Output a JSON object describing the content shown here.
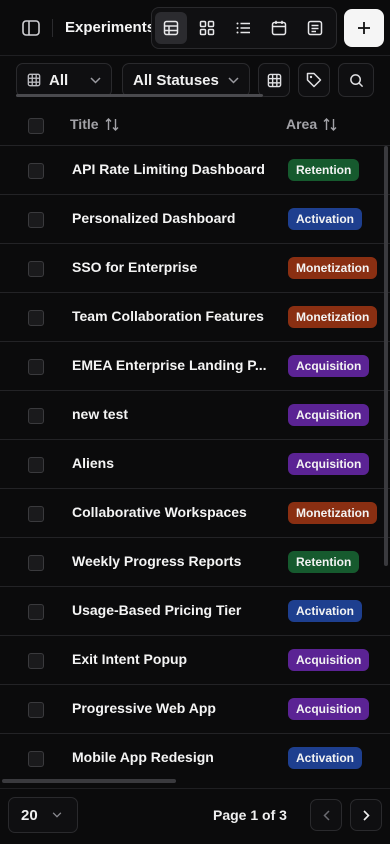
{
  "header": {
    "title": "Experiments",
    "views": [
      {
        "icon": "table-view-icon",
        "active": true
      },
      {
        "icon": "grid-view-icon",
        "active": false
      },
      {
        "icon": "list-view-icon",
        "active": false
      },
      {
        "icon": "calendar-view-icon",
        "active": false
      },
      {
        "icon": "document-view-icon",
        "active": false
      }
    ],
    "add_icon": "plus-icon"
  },
  "filters": {
    "scope_label": "All",
    "status_label": "All Statuses"
  },
  "table": {
    "columns": [
      "Title",
      "Area"
    ],
    "rows": [
      {
        "title": "API Rate Limiting Dashboard",
        "area": "Retention"
      },
      {
        "title": "Personalized Dashboard",
        "area": "Activation"
      },
      {
        "title": "SSO for Enterprise",
        "area": "Monetization"
      },
      {
        "title": "Team Collaboration Features",
        "area": "Monetization"
      },
      {
        "title": "EMEA Enterprise Landing P...",
        "area": "Acquisition"
      },
      {
        "title": "new test",
        "area": "Acquisition"
      },
      {
        "title": "Aliens",
        "area": "Acquisition"
      },
      {
        "title": "Collaborative Workspaces",
        "area": "Monetization"
      },
      {
        "title": "Weekly Progress Reports",
        "area": "Retention"
      },
      {
        "title": "Usage-Based Pricing Tier",
        "area": "Activation"
      },
      {
        "title": "Exit Intent Popup",
        "area": "Acquisition"
      },
      {
        "title": "Progressive Web App",
        "area": "Acquisition"
      },
      {
        "title": "Mobile App Redesign",
        "area": "Activation"
      }
    ]
  },
  "area_colors": {
    "Retention": "#165a2e",
    "Activation": "#1e3f8f",
    "Monetization": "#8a2f12",
    "Acquisition": "#5b2394"
  },
  "footer": {
    "page_size": "20",
    "page_info": "Page 1 of 3"
  }
}
